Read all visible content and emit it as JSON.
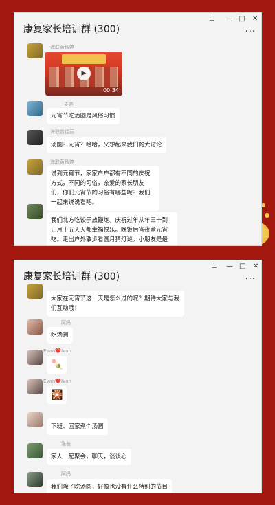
{
  "screenshot1": {
    "title": "康复家长培训群 (300)",
    "messages": [
      {
        "sender": "海联黄秋婷",
        "type": "video",
        "duration": "00:34"
      },
      {
        "sender": "麦爸",
        "text": "元宵节吃汤圆是风俗习惯"
      },
      {
        "sender": "海联曾佳丽",
        "text": "汤圆？元宵？哈哈，又想起来我们的大讨论"
      },
      {
        "sender": "海联黄秋婷",
        "text": "说到元宵节，家家户户都有不同的庆祝方式，不同的习俗，亲爱的家长朋友们，你们元宵节的习俗有哪些呢？我们一起来说说看吧。"
      },
      {
        "sender": "",
        "text": "我们北方吃饺子放鞭炮。庆祝过年从年三十到正月十五天天都幸福快乐。晚饭后宵夜煮元宵吃。走出户外散步看圆月猜灯谜。小朋友是最开心了"
      }
    ]
  },
  "screenshot2": {
    "title": "康复家长培训群 (300)",
    "messages": [
      {
        "sender": "",
        "text": "大家在元宵节这一天是怎么过的呢？期待大家与我们互动哦！"
      },
      {
        "sender": "阿妈",
        "text": "吃汤圆"
      },
      {
        "sender": "Evan❤️Ivan",
        "text": "🍡"
      },
      {
        "sender": "Evan❤️Ivan",
        "text": "🎇"
      },
      {
        "sender": "",
        "text": "下班、回家煮个汤圆"
      },
      {
        "sender": "淮爸",
        "text": "家人一起聚会，聊天，谈谈心"
      },
      {
        "sender": "阿妈",
        "text": "我们除了吃汤圆，好像也没有什么特别的节目"
      }
    ]
  },
  "window_controls": {
    "pin": "⊥",
    "minimize": "—",
    "maximize": "□",
    "close": "✕",
    "more": "···"
  },
  "colors": {
    "background": "#a3180f",
    "window": "#f3f3f3",
    "bubble": "#ffffff"
  }
}
